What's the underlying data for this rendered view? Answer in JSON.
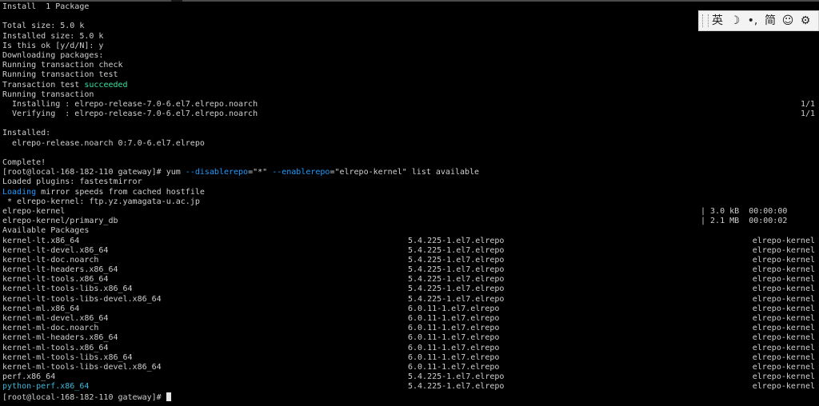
{
  "terminal": {
    "lines": [
      "Install  1 Package",
      "",
      "Total size: 5.0 k",
      "Installed size: 5.0 k",
      "Is this ok [y/d/N]: y",
      "Downloading packages:",
      "Running transaction check",
      "Running transaction test",
      "Transaction test ",
      "Running transaction",
      "  Installing : elrepo-release-7.0-6.el7.elrepo.noarch",
      "  Verifying  : elrepo-release-7.0-6.el7.elrepo.noarch",
      "",
      "Installed:",
      "  elrepo-release.noarch 0:7.0-6.el7.elrepo",
      "",
      "Complete!"
    ],
    "succeeded_word": "succeeded",
    "progress_installing": "1/1",
    "progress_verifying": "1/1",
    "command": {
      "prompt": "[root@local-168-182-110 gateway]# ",
      "cmd": "yum ",
      "opt1": "--disablerepo",
      "val1": "=\"*\" ",
      "opt2": "--enablerepo",
      "val2": "=\"elrepo-kernel\" list available"
    },
    "plugins_line": "Loaded plugins: fastestmirror",
    "loading_word": "Loading",
    "loading_rest": " mirror speeds from cached hostfile",
    "mirror_line": " * elrepo-kernel: ftp.yz.yamagata-u.ac.jp",
    "repos": [
      {
        "name": "elrepo-kernel",
        "size": "| 3.0 kB  00:00:00"
      },
      {
        "name": "elrepo-kernel/primary_db",
        "size": "| 2.1 MB  00:00:02"
      }
    ],
    "available_header": "Available Packages",
    "packages": [
      {
        "name": "kernel-lt.x86_64",
        "version": "5.4.225-1.el7.elrepo",
        "repo": "elrepo-kernel"
      },
      {
        "name": "kernel-lt-devel.x86_64",
        "version": "5.4.225-1.el7.elrepo",
        "repo": "elrepo-kernel"
      },
      {
        "name": "kernel-lt-doc.noarch",
        "version": "5.4.225-1.el7.elrepo",
        "repo": "elrepo-kernel"
      },
      {
        "name": "kernel-lt-headers.x86_64",
        "version": "5.4.225-1.el7.elrepo",
        "repo": "elrepo-kernel"
      },
      {
        "name": "kernel-lt-tools.x86_64",
        "version": "5.4.225-1.el7.elrepo",
        "repo": "elrepo-kernel"
      },
      {
        "name": "kernel-lt-tools-libs.x86_64",
        "version": "5.4.225-1.el7.elrepo",
        "repo": "elrepo-kernel"
      },
      {
        "name": "kernel-lt-tools-libs-devel.x86_64",
        "version": "5.4.225-1.el7.elrepo",
        "repo": "elrepo-kernel"
      },
      {
        "name": "kernel-ml.x86_64",
        "version": "6.0.11-1.el7.elrepo",
        "repo": "elrepo-kernel"
      },
      {
        "name": "kernel-ml-devel.x86_64",
        "version": "6.0.11-1.el7.elrepo",
        "repo": "elrepo-kernel"
      },
      {
        "name": "kernel-ml-doc.noarch",
        "version": "6.0.11-1.el7.elrepo",
        "repo": "elrepo-kernel"
      },
      {
        "name": "kernel-ml-headers.x86_64",
        "version": "6.0.11-1.el7.elrepo",
        "repo": "elrepo-kernel"
      },
      {
        "name": "kernel-ml-tools.x86_64",
        "version": "6.0.11-1.el7.elrepo",
        "repo": "elrepo-kernel"
      },
      {
        "name": "kernel-ml-tools-libs.x86_64",
        "version": "6.0.11-1.el7.elrepo",
        "repo": "elrepo-kernel"
      },
      {
        "name": "kernel-ml-tools-libs-devel.x86_64",
        "version": "6.0.11-1.el7.elrepo",
        "repo": "elrepo-kernel"
      },
      {
        "name": "perf.x86_64",
        "version": "5.4.225-1.el7.elrepo",
        "repo": "elrepo-kernel"
      },
      {
        "name": "python-perf.x86_64",
        "version": "5.4.225-1.el7.elrepo",
        "repo": "elrepo-kernel"
      }
    ],
    "final_prompt": "[root@local-168-182-110 gateway]# "
  },
  "ime": {
    "lang": "英",
    "moon_icon": "☽",
    "punct_icon": "•,",
    "mode": "简",
    "emoji_icon": "☺",
    "settings_icon": "⚙"
  },
  "colors": {
    "background": "#000000",
    "text": "#cfcfcf",
    "success": "#34e2a0",
    "option": "#1e9bff",
    "highlight": "#38b9d9"
  }
}
